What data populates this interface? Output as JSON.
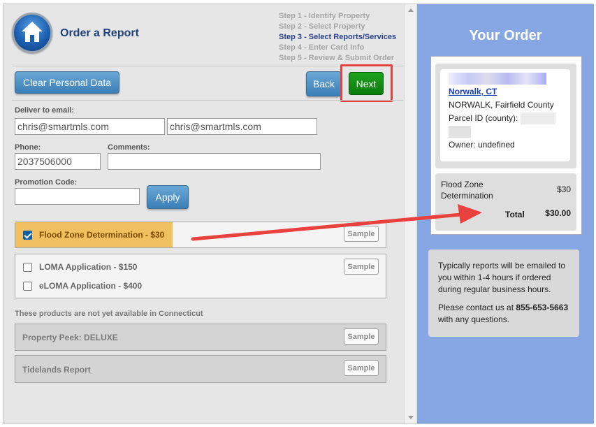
{
  "header": {
    "title": "Order a Report",
    "steps": [
      "Step 1 - Identify Property",
      "Step 2 - Select Property",
      "Step 3 - Select Reports/Services",
      "Step 4 - Enter Card Info",
      "Step 5 - Review & Submit Order"
    ],
    "active_step": 2
  },
  "toolbar": {
    "clear_label": "Clear Personal Data",
    "back_label": "Back",
    "next_label": "Next"
  },
  "form": {
    "email_label": "Deliver to email:",
    "email_value": "chris@smartmls.com",
    "email_confirm_value": "chris@smartmls.com",
    "phone_label": "Phone:",
    "phone_value": "2037506000",
    "comments_label": "Comments:",
    "comments_value": "",
    "promo_label": "Promotion Code:",
    "promo_value": "",
    "apply_label": "Apply"
  },
  "products": {
    "selected": {
      "label": "Flood Zone Determination - $30",
      "checked": true,
      "sample": "Sample"
    },
    "group": [
      {
        "label": "LOMA Application - $150",
        "checked": false
      },
      {
        "label": "eLOMA Application - $400",
        "checked": false
      }
    ],
    "group_sample": "Sample",
    "unavailable_notice": "These products are not yet available in Connecticut",
    "unavailable": [
      {
        "label": "Property Peek: DELUXE",
        "sample": "Sample"
      },
      {
        "label": "Tidelands Report",
        "sample": "Sample"
      }
    ]
  },
  "order": {
    "heading": "Your Order",
    "property_link": "Norwalk, CT",
    "property_county": "NORWALK, Fairfield County",
    "parcel_label": "Parcel ID (county):",
    "owner": "Owner: undefined",
    "item_name": "Flood Zone Determination",
    "item_price": "$30",
    "total_label": "Total",
    "total_value": "$30.00",
    "info_1": "Typically reports will be emailed to you within 1-4 hours if ordered during regular business hours.",
    "info_2_pre": "Please contact us at ",
    "info_2_phone": "855-653-5663",
    "info_2_post": " with any questions."
  },
  "colors": {
    "accent_blue": "#3b7fb8",
    "next_green": "#0b7a0b",
    "highlight": "#f0c060",
    "order_panel": "#87a7e4",
    "callout_red": "#e8413e"
  }
}
